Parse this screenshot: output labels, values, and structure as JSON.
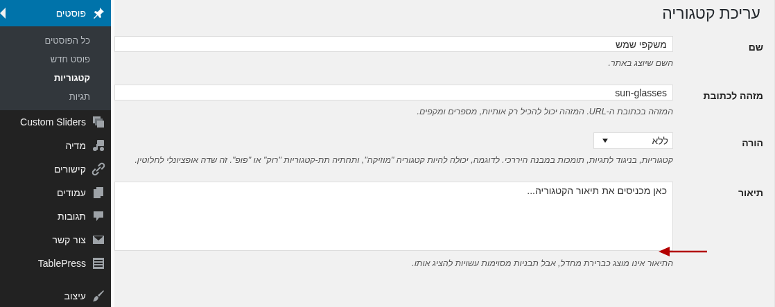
{
  "page_title": "עריכת קטגוריה",
  "form": {
    "fields": [
      {
        "label": "שם",
        "kind": "text",
        "value": "משקפי שמש",
        "hint": "השם שיוצג באתר."
      },
      {
        "label": "מזהה לכתובת",
        "kind": "text",
        "value": "sun-glasses",
        "hint": "המזהה בכתובת ה-URL. המזהה יכול להכיל רק אותיות, מספרים ומקפים."
      },
      {
        "label": "הורה",
        "kind": "select",
        "value": "ללא",
        "hint": "קטגוריות, בניגוד לתגיות, תומכות במבנה היררכי. לדוגמה, יכולה להיות קטגוריה \"מוזיקה\", ותחתיה תת-קטגוריות \"רוק\" או \"פופ\". זה שדה אופציונלי לחלוטין."
      },
      {
        "label": "תיאור",
        "kind": "textarea",
        "value": "כאן מכניסים את תיאור הקטגוריה...",
        "hint": "התיאור אינו מוצג כברירת מחדל, אבל תבניות מסוימות עשויות להציג אותו."
      }
    ]
  },
  "sidebar": {
    "items": [
      {
        "label": "פוסטים",
        "kind": "pin",
        "selected": true,
        "children": [
          {
            "label": "כל הפוסטים",
            "selected": false
          },
          {
            "label": "פוסט חדש",
            "selected": false
          },
          {
            "label": "קטגוריות",
            "selected": true
          },
          {
            "label": "תגיות",
            "selected": false
          }
        ]
      },
      {
        "label": "Custom Sliders",
        "kind": "slides",
        "selected": false
      },
      {
        "label": "מדיה",
        "kind": "media",
        "selected": false
      },
      {
        "label": "קישורים",
        "kind": "link",
        "selected": false
      },
      {
        "label": "עמודים",
        "kind": "pages",
        "selected": false
      },
      {
        "label": "תגובות",
        "kind": "comment",
        "selected": false
      },
      {
        "label": "צור קשר",
        "kind": "mail",
        "selected": false
      },
      {
        "label": "TablePress",
        "kind": "table",
        "selected": false
      },
      {
        "label": "עיצוב",
        "kind": "brush",
        "selected": false,
        "separator_before": true
      }
    ]
  }
}
